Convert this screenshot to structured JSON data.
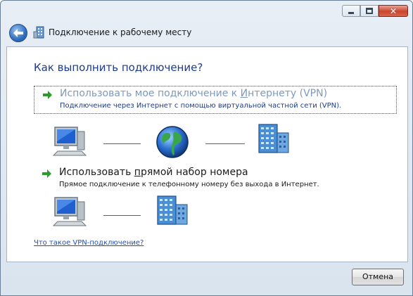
{
  "window": {
    "title": "Подключение к рабочему месту"
  },
  "heading": "Как выполнить подключение?",
  "options": [
    {
      "title_before": "Использовать мое подключение к ",
      "title_underlined": "И",
      "title_after": "нтернету (VPN)",
      "description": "Подключение через Интернет с помощью виртуальной частной сети (VPN)."
    },
    {
      "title_before": "Использовать ",
      "title_underlined": "п",
      "title_after": "рямой набор номера",
      "description": "Прямое подключение к телефонному номеру без выхода в Интернет."
    }
  ],
  "help_link": "Что такое VPN-подключение?",
  "buttons": {
    "cancel": "Отмена"
  },
  "icons": {
    "back": "back-arrow-icon",
    "window": "workplace-connection-icon",
    "option_arrow": "green-arrow-icon",
    "computer": "computer-icon",
    "globe": "globe-icon",
    "server": "office-building-icon"
  },
  "colors": {
    "heading": "#1e3b8a",
    "option_arrow": "#2e9a2e",
    "link": "#1f4fb3"
  }
}
